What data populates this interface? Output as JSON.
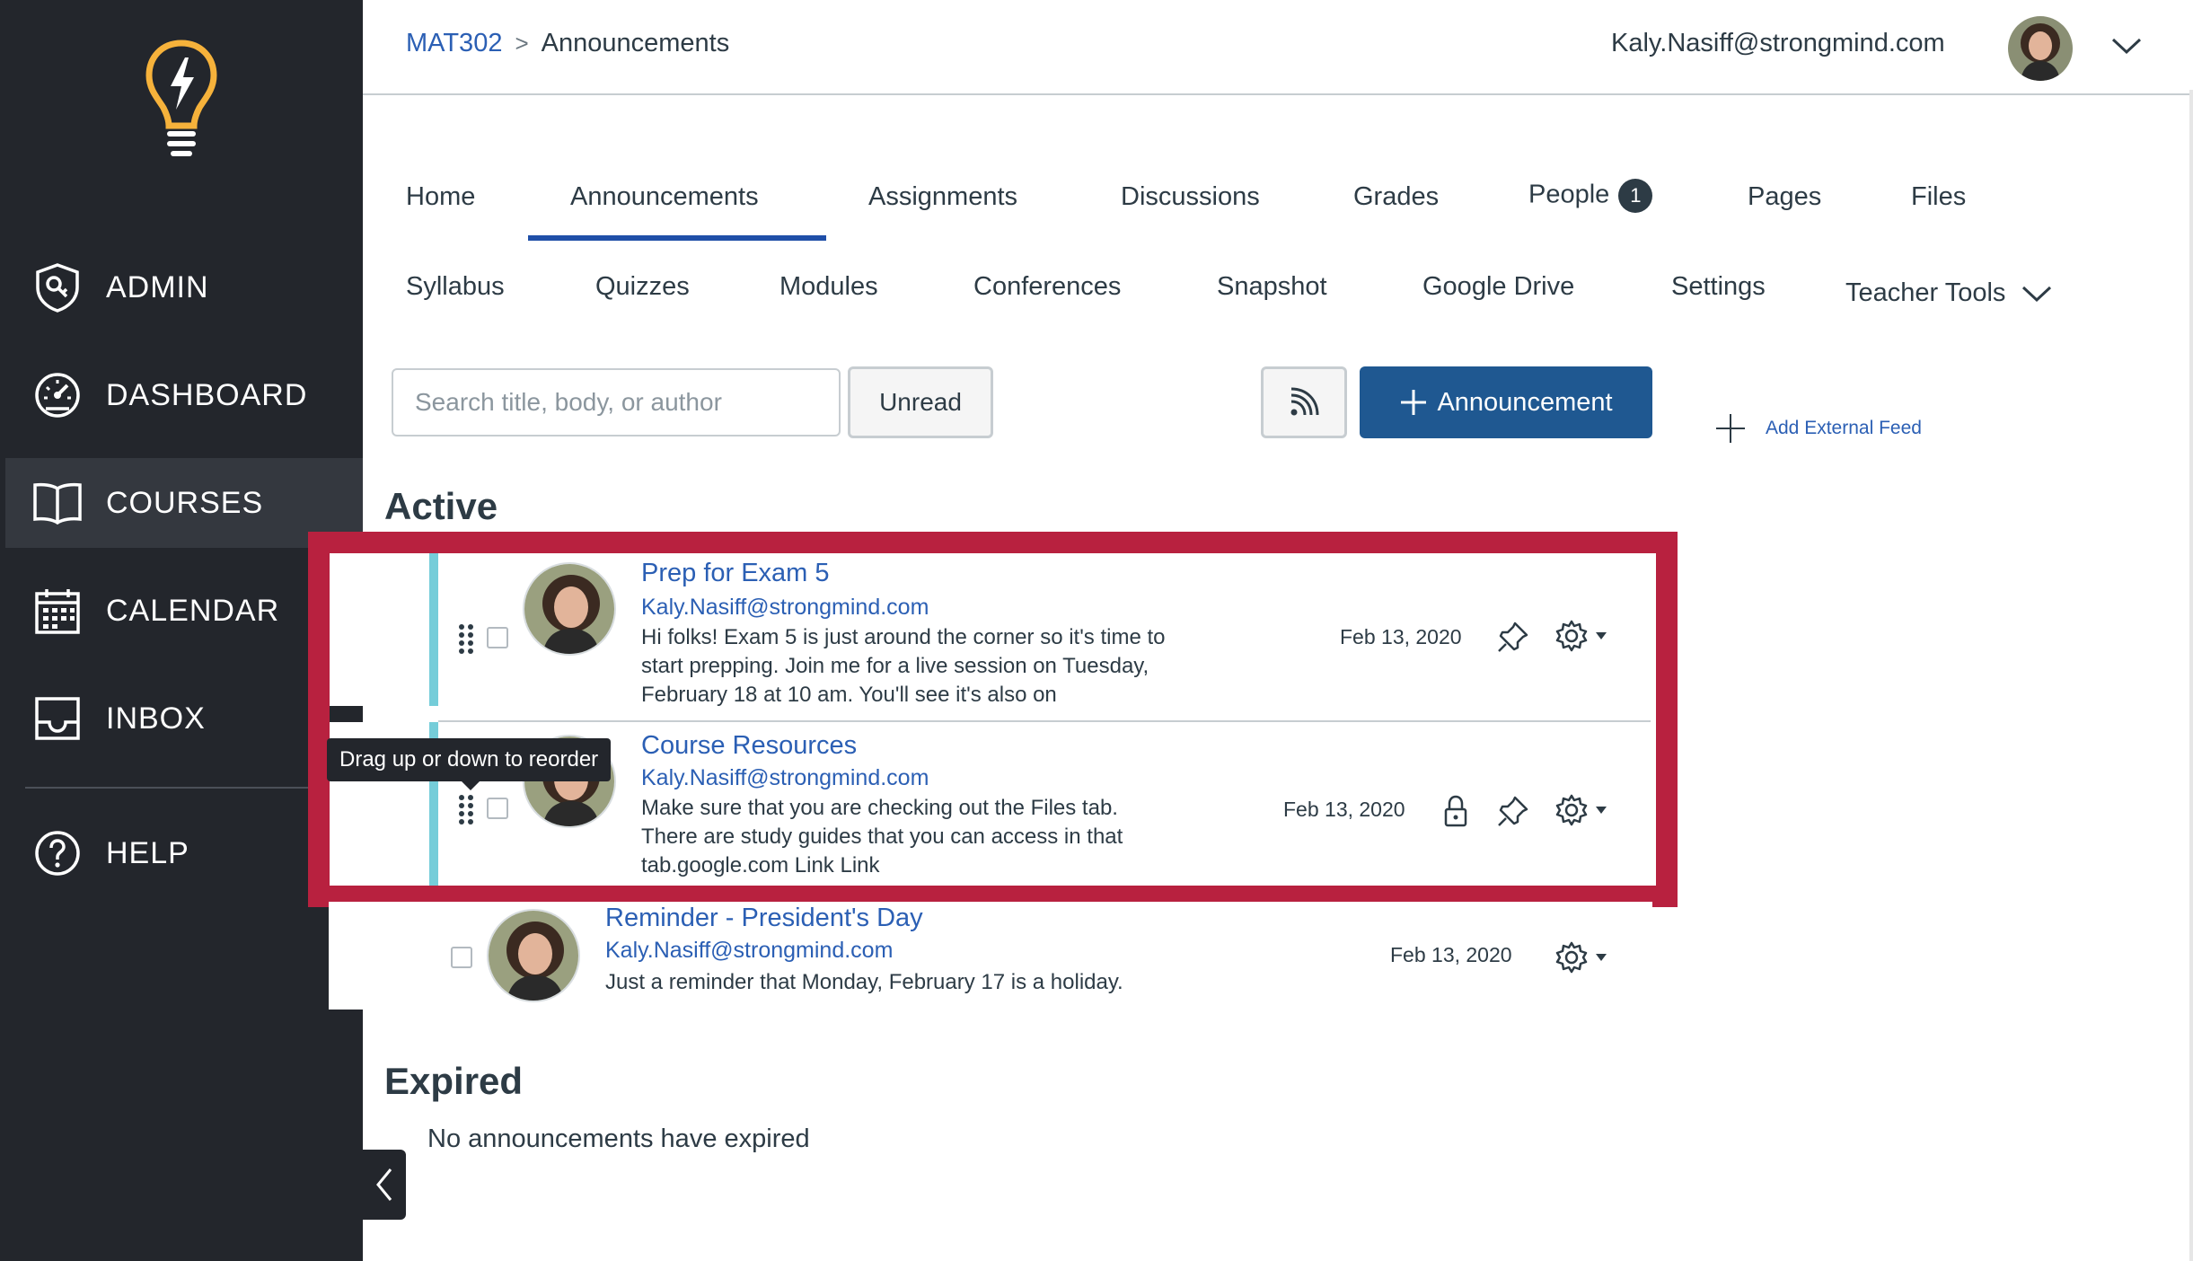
{
  "sidebar": {
    "items": [
      {
        "label": "ADMIN",
        "icon": "admin-shield-icon"
      },
      {
        "label": "DASHBOARD",
        "icon": "dashboard-gauge-icon"
      },
      {
        "label": "COURSES",
        "icon": "courses-book-icon",
        "active": true
      },
      {
        "label": "CALENDAR",
        "icon": "calendar-icon"
      },
      {
        "label": "INBOX",
        "icon": "inbox-tray-icon"
      },
      {
        "label": "HELP",
        "icon": "help-question-icon"
      }
    ]
  },
  "header": {
    "breadcrumb": {
      "course": "MAT302",
      "separator": ">",
      "current": "Announcements"
    },
    "user_email": "Kaly.Nasiff@strongmind.com"
  },
  "tabs": {
    "row1": [
      {
        "label": "Home"
      },
      {
        "label": "Announcements",
        "active": true
      },
      {
        "label": "Assignments"
      },
      {
        "label": "Discussions"
      },
      {
        "label": "Grades"
      },
      {
        "label": "People",
        "badge": "1"
      },
      {
        "label": "Pages"
      },
      {
        "label": "Files"
      }
    ],
    "row2": [
      {
        "label": "Syllabus"
      },
      {
        "label": "Quizzes"
      },
      {
        "label": "Modules"
      },
      {
        "label": "Conferences"
      },
      {
        "label": "Snapshot"
      },
      {
        "label": "Google Drive"
      },
      {
        "label": "Settings"
      },
      {
        "label": "Teacher Tools"
      }
    ]
  },
  "toolbar": {
    "search_placeholder": "Search title, body, or author",
    "unread_label": "Unread",
    "add_announcement_label": "Announcement",
    "add_external_feed_label": "Add External Feed"
  },
  "sections": {
    "active_heading": "Active",
    "expired_heading": "Expired",
    "expired_empty": "No announcements have expired"
  },
  "announcements": [
    {
      "title": "Prep for Exam 5",
      "author": "Kaly.Nasiff@strongmind.com",
      "body": "Hi folks! Exam 5 is just around the corner so it's time to start prepping. Join me for a live session on Tuesday, February 18 at 10 am. You'll see it's also on",
      "date": "Feb 13, 2020",
      "pinned": true,
      "locked": false
    },
    {
      "title": "Course Resources",
      "author": "Kaly.Nasiff@strongmind.com",
      "body": "Make sure that you are checking out the Files tab. There are study guides that you can access in that tab.google.com Link Link",
      "date": "Feb 13, 2020",
      "pinned": true,
      "locked": true
    },
    {
      "title": "Reminder - President's Day",
      "author": "Kaly.Nasiff@strongmind.com",
      "body": "Just a reminder that Monday, February 17 is a holiday.",
      "date": "Feb 13, 2020",
      "pinned": false,
      "locked": false
    }
  ],
  "tooltip": "Drag up or down to reorder",
  "colors": {
    "sidebar_bg": "#23262c",
    "link_blue": "#2b5fb4",
    "primary_button": "#1f5891",
    "highlight_red": "#b8213f",
    "pinned_accent": "#75cdd9",
    "logo_yellow": "#f6b23b"
  }
}
